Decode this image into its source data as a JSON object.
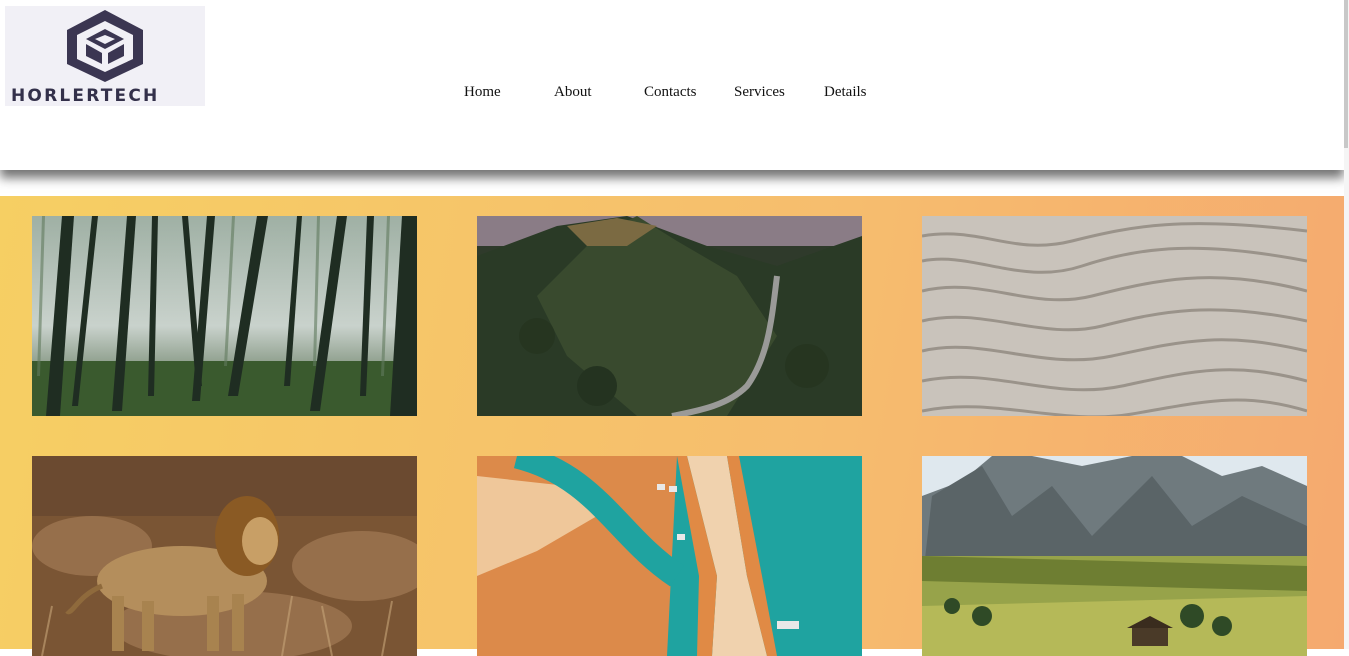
{
  "brand": {
    "name": "HORLERTECH"
  },
  "nav": {
    "items": [
      "Home",
      "About",
      "Contacts",
      "Services",
      "Details"
    ]
  },
  "gallery": {
    "images": [
      {
        "subject": "misty forest"
      },
      {
        "subject": "road through forested mountain"
      },
      {
        "subject": "sand ripples"
      },
      {
        "subject": "lion in grass"
      },
      {
        "subject": "aerial beach and sea"
      },
      {
        "subject": "mountain meadow"
      }
    ]
  },
  "colors": {
    "gradient_start": "#f6cf63",
    "gradient_end": "#f5a96f",
    "logo_color": "#3b3652"
  }
}
